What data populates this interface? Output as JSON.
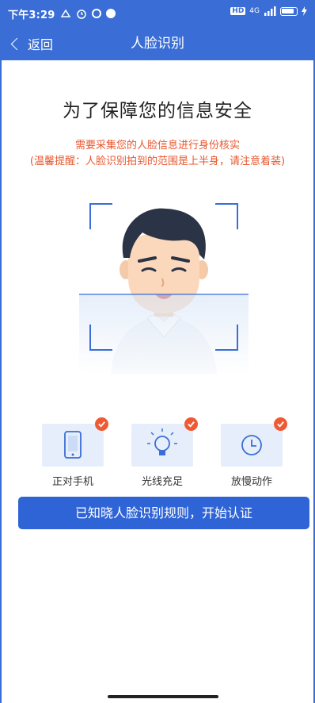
{
  "status_bar": {
    "time": "下午3:29",
    "network": "4G"
  },
  "nav": {
    "back_label": "返回",
    "title": "人脸识别"
  },
  "content": {
    "headline": "为了保障您的信息安全",
    "notice_line1": "需要采集您的人脸信息进行身份核实",
    "notice_line2": "(温馨提醒：人脸识别拍到的范围是上半身，请注意着装)"
  },
  "tips": [
    {
      "label": "正对手机",
      "icon": "phone-icon"
    },
    {
      "label": "光线充足",
      "icon": "lightbulb-icon"
    },
    {
      "label": "放慢动作",
      "icon": "clock-icon"
    }
  ],
  "primary_button": {
    "label": "已知晓人脸识别规则，开始认证"
  },
  "colors": {
    "brand": "#3a6ed6",
    "button": "#2f64d6",
    "warning": "#e8572f",
    "badge": "#ef5a34"
  }
}
